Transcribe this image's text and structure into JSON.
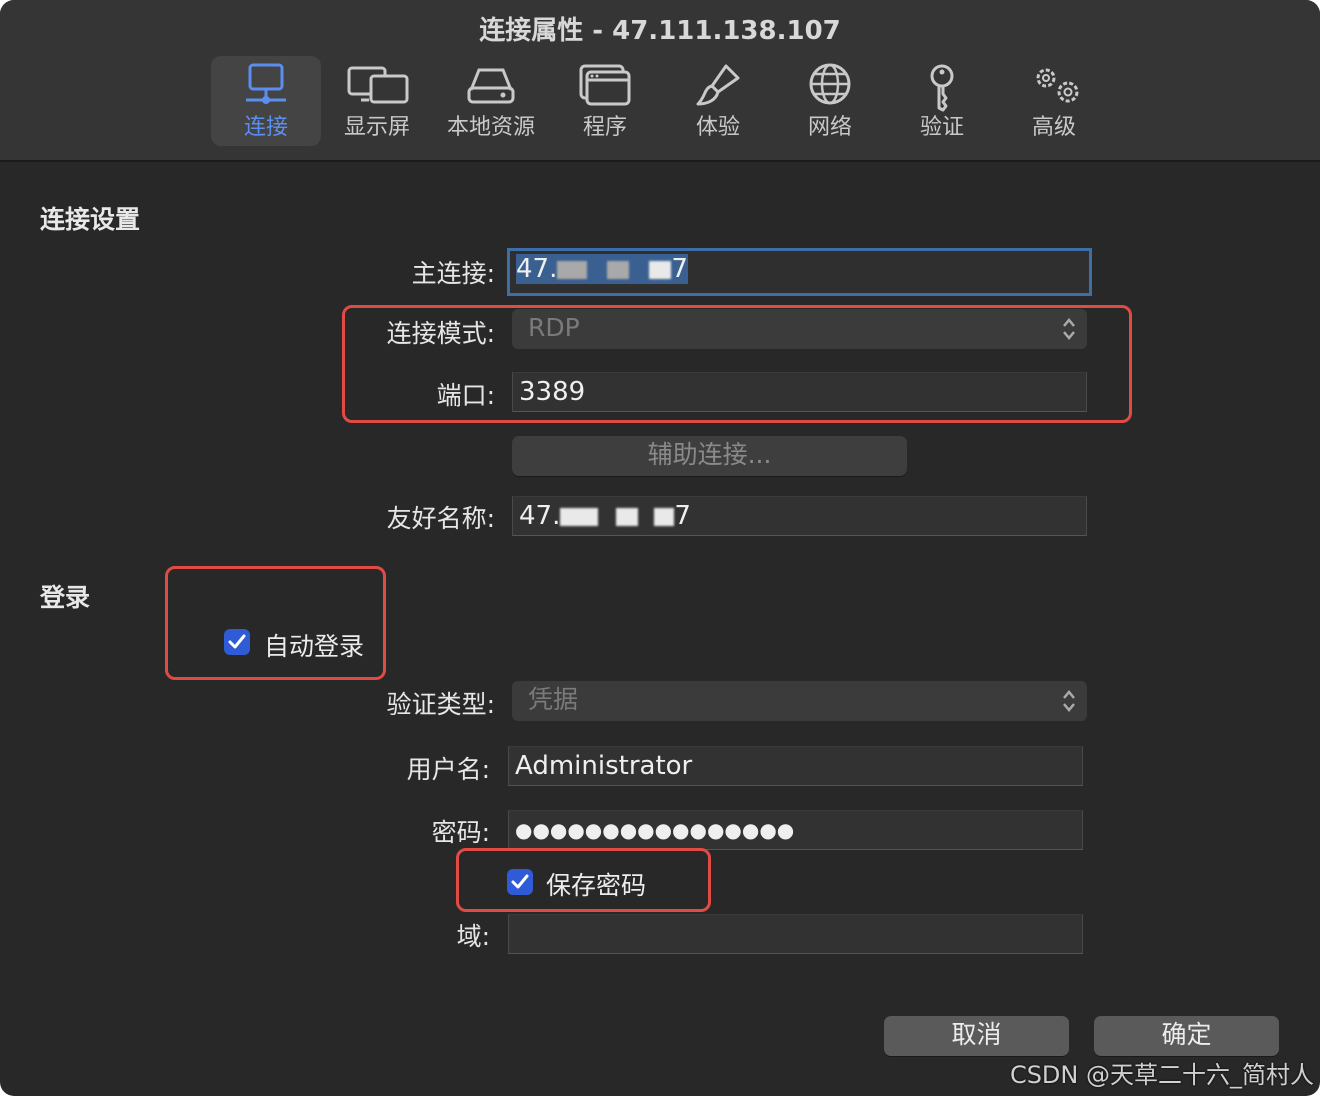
{
  "window": {
    "title": "连接属性 - 47.111.138.107"
  },
  "tabs": [
    {
      "label": "连接",
      "icon": "monitor-network-icon",
      "selected": true
    },
    {
      "label": "显示屏",
      "icon": "displays-icon",
      "selected": false
    },
    {
      "label": "本地资源",
      "icon": "drive-icon",
      "selected": false
    },
    {
      "label": "程序",
      "icon": "app-window-icon",
      "selected": false
    },
    {
      "label": "体验",
      "icon": "paintbrush-icon",
      "selected": false
    },
    {
      "label": "网络",
      "icon": "globe-icon",
      "selected": false
    },
    {
      "label": "验证",
      "icon": "key-icon",
      "selected": false
    },
    {
      "label": "高级",
      "icon": "gears-icon",
      "selected": false
    }
  ],
  "connection": {
    "section_title": "连接设置",
    "host_label": "主连接:",
    "host_value_prefix": "47.",
    "host_value_suffix": "7",
    "mode_label": "连接模式:",
    "mode_value": "RDP",
    "port_label": "端口:",
    "port_value": "3389",
    "assist_button": "辅助连接...",
    "friendly_label": "友好名称:",
    "friendly_value_prefix": "47.",
    "friendly_value_suffix": "7"
  },
  "login": {
    "section_title": "登录",
    "auto_login_label": "自动登录",
    "auto_login_checked": true,
    "auth_type_label": "验证类型:",
    "auth_type_value": "凭据",
    "username_label": "用户名:",
    "username_value": "Administrator",
    "password_label": "密码:",
    "password_value": "●●●●●●●●●●●●●●●●",
    "save_password_label": "保存密码",
    "save_password_checked": true,
    "domain_label": "域:",
    "domain_value": ""
  },
  "footer": {
    "cancel_label": "取消",
    "ok_label": "确定"
  },
  "watermark": "CSDN @天草二十六_简村人",
  "colors": {
    "accent": "#5a8ff0",
    "checkbox": "#2f5bd6",
    "annotation_red": "#e14b46",
    "window_bg": "#282828",
    "toolbar_bg": "#353535"
  }
}
